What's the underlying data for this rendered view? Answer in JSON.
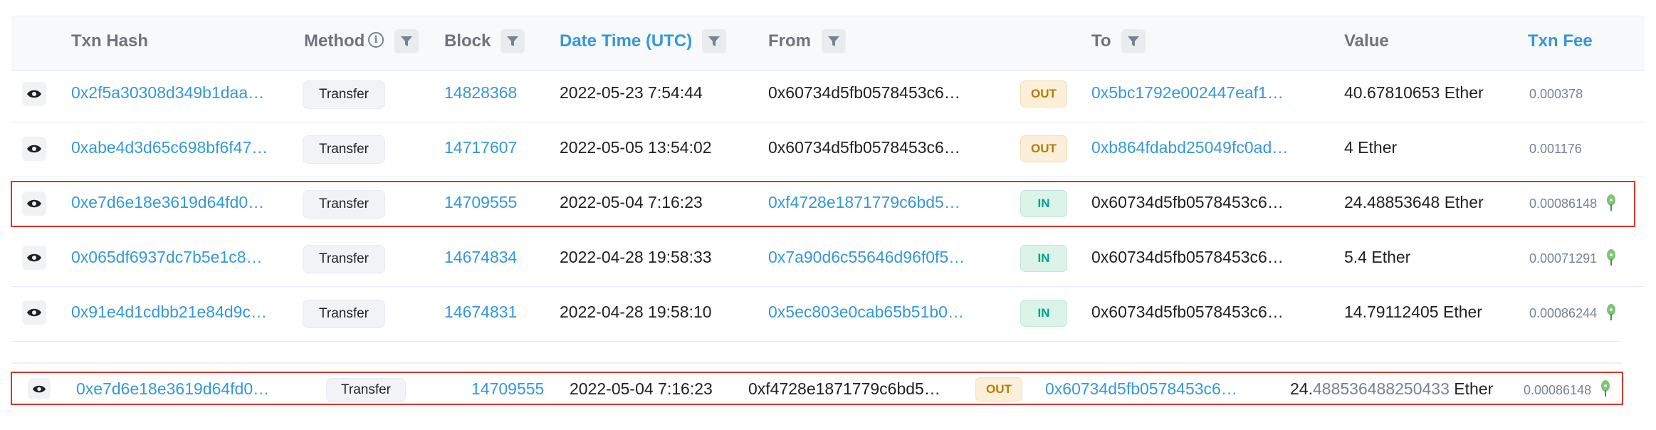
{
  "header": {
    "txn_hash": "Txn Hash",
    "method": "Method",
    "block": "Block",
    "date_time": "Date Time (UTC)",
    "from": "From",
    "to": "To",
    "value": "Value",
    "txn_fee": "Txn Fee"
  },
  "rows": [
    {
      "hash": "0x2f5a30308d349b1daa…",
      "method": "Transfer",
      "block": "14828368",
      "datetime": "2022-05-23 7:54:44",
      "from": "0x60734d5fb0578453c6…",
      "direction": "OUT",
      "to": "0x5bc1792e002447eaf1…",
      "value": "40.67810653 Ether",
      "fee": "0.000378"
    },
    {
      "hash": "0xabe4d3d65c698bf6f47…",
      "method": "Transfer",
      "block": "14717607",
      "datetime": "2022-05-05 13:54:02",
      "from": "0x60734d5fb0578453c6…",
      "direction": "OUT",
      "to": "0xb864fdabd25049fc0ad…",
      "value": "4 Ether",
      "fee": "0.001176"
    },
    {
      "hash": "0xe7d6e18e3619d64fd0…",
      "method": "Transfer",
      "block": "14709555",
      "datetime": "2022-05-04 7:16:23",
      "from": "0xf4728e1871779c6bd5…",
      "direction": "IN",
      "to": "0x60734d5fb0578453c6…",
      "value": "24.48853648 Ether",
      "fee": "0.00086148"
    },
    {
      "hash": "0x065df6937dc7b5e1c8…",
      "method": "Transfer",
      "block": "14674834",
      "datetime": "2022-04-28 19:58:33",
      "from": "0x7a90d6c55646d96f0f5…",
      "direction": "IN",
      "to": "0x60734d5fb0578453c6…",
      "value": "5.4 Ether",
      "fee": "0.00071291"
    },
    {
      "hash": "0x91e4d1cdbb21e84d9c…",
      "method": "Transfer",
      "block": "14674831",
      "datetime": "2022-04-28 19:58:10",
      "from": "0x5ec803e0cab65b51b0…",
      "direction": "IN",
      "to": "0x60734d5fb0578453c6…",
      "value": "14.79112405 Ether",
      "fee": "0.00086244"
    }
  ],
  "extra_row": {
    "hash": "0xe7d6e18e3619d64fd0…",
    "method": "Transfer",
    "block": "14709555",
    "datetime": "2022-05-04 7:16:23",
    "from": "0xf4728e1871779c6bd5…",
    "direction": "OUT",
    "to": "0x60734d5fb0578453c6…",
    "value_int": "24.",
    "value_frac": "488536488250433",
    "value_unit": " Ether",
    "fee": "0.00086148"
  },
  "colors": {
    "link": "#3498db",
    "out_badge_bg": "#fbefd9",
    "out_badge_text": "#b47d00",
    "in_badge_bg": "#dcf3ea",
    "in_badge_text": "#00a186",
    "highlight_border": "#d9342b"
  },
  "icons": {
    "eye": "eye-icon",
    "filter": "filter-icon",
    "info": "info-icon",
    "gas": "gas-pump-icon"
  }
}
